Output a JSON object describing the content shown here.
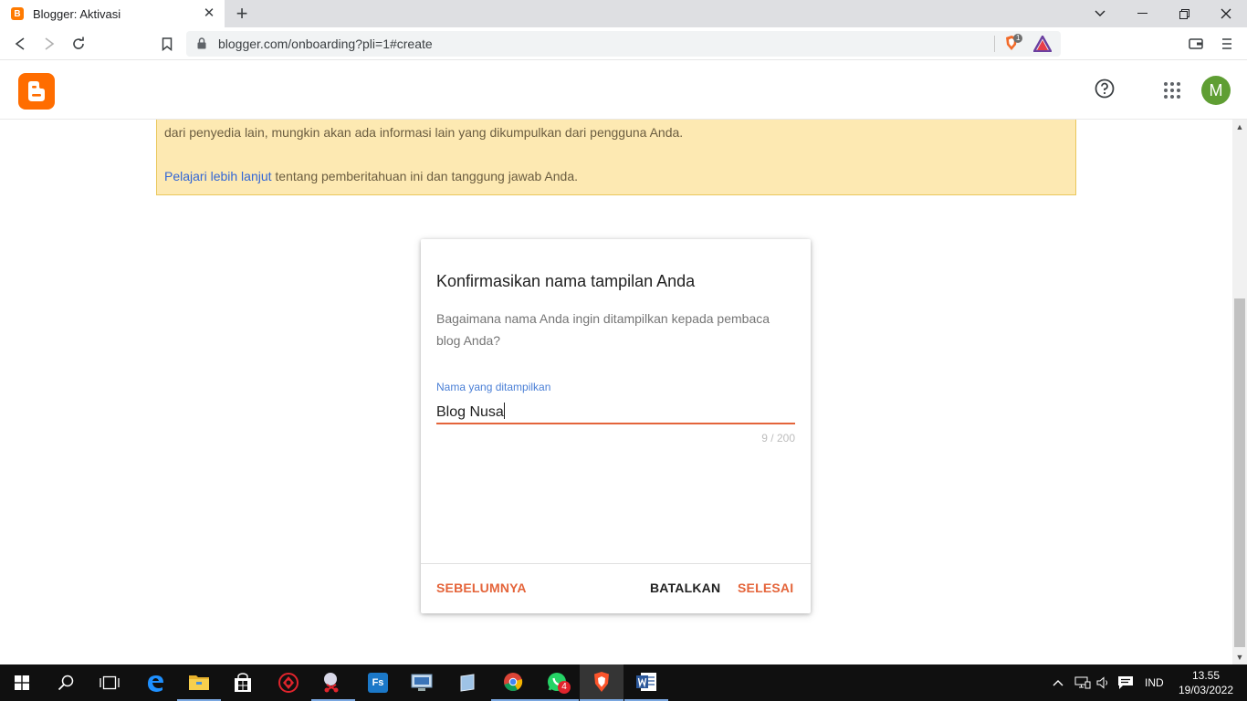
{
  "browser": {
    "tab_title": "Blogger: Aktivasi",
    "tab_favicon_letter": "B",
    "url": "blogger.com/onboarding?pli=1#create",
    "shield_badge": "1"
  },
  "header": {
    "avatar_letter": "M"
  },
  "notice": {
    "line1": "dari penyedia lain, mungkin akan ada informasi lain yang dikumpulkan dari pengguna Anda.",
    "link_text": "Pelajari lebih lanjut",
    "line2_rest": " tentang pemberitahuan ini dan tanggung jawab Anda."
  },
  "dialog": {
    "title": "Konfirmasikan nama tampilan Anda",
    "description": "Bagaimana nama Anda ingin ditampilkan kepada pembaca blog Anda?",
    "field_label": "Nama yang ditampilkan",
    "field_value": "Blog Nusa",
    "char_count": "9 / 200",
    "btn_previous": "SEBELUMNYA",
    "btn_cancel": "BATALKAN",
    "btn_done": "SELESAI"
  },
  "taskbar": {
    "whatsapp_badge": "4",
    "language": "IND",
    "time": "13.55",
    "date": "19/03/2022",
    "photoscape_label": "Fs"
  },
  "colors": {
    "accent": "#e4643a",
    "blogger_orange": "#ff6d00",
    "link_blue": "#3367d6",
    "notice_bg": "#fde9b2"
  }
}
